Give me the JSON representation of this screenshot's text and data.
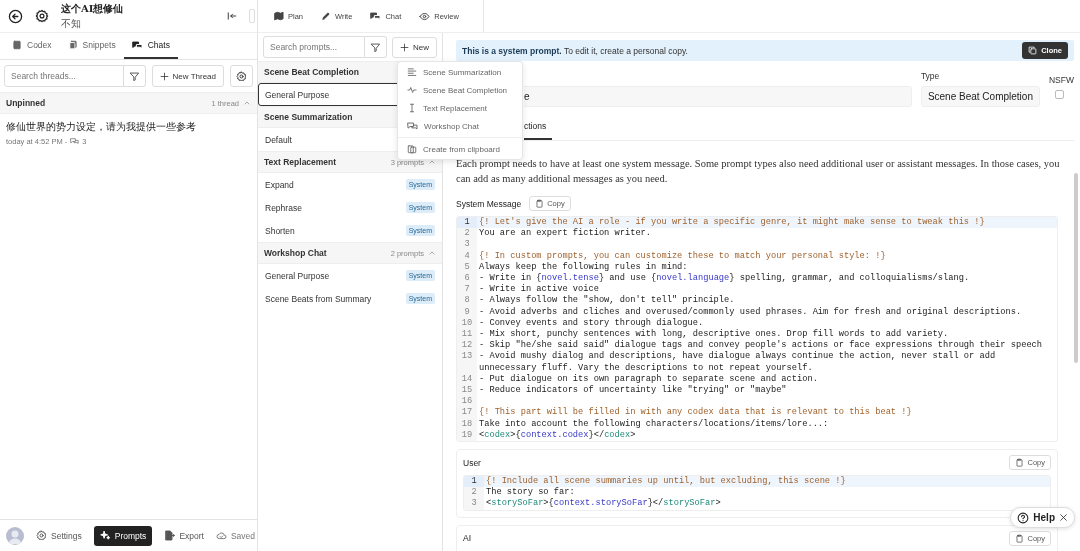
{
  "sidebar": {
    "header": {
      "title": "这个AI想修仙",
      "subtitle": "不知"
    },
    "tabs": [
      {
        "label": "Codex",
        "selected": false
      },
      {
        "label": "Snippets",
        "selected": false
      },
      {
        "label": "Chats",
        "selected": true
      }
    ],
    "thread_search": {
      "placeholder": "Search threads..."
    },
    "new_thread_button": "New Thread",
    "thread_group": {
      "title": "Unpinned",
      "count": "1 thread",
      "expanded": true
    },
    "threads": [
      {
        "title": "修仙世界的势力设定，请为我提供一些参考",
        "time": "today at 4:52 PM -",
        "replies": "3"
      }
    ],
    "footer": {
      "buttons": [
        {
          "label": "Settings",
          "selected": false
        },
        {
          "label": "Prompts",
          "selected": true
        },
        {
          "label": "Export",
          "selected": false
        }
      ],
      "status": "Saved"
    }
  },
  "top_nav": [
    "Plan",
    "Write",
    "Chat",
    "Review"
  ],
  "prompt_search": {
    "placeholder": "Search prompts..."
  },
  "new_button": "New",
  "prompt_groups": [
    {
      "title": "Scene Beat Completion",
      "items": [
        {
          "label": "General Purpose",
          "selected": true
        }
      ]
    },
    {
      "title": "Scene Summarization",
      "items": [
        {
          "label": "Default",
          "selected": false
        }
      ]
    },
    {
      "title": "Text Replacement",
      "count": "3 prompts",
      "expanded": true,
      "items": [
        {
          "label": "Expand",
          "selected": false,
          "badge": "System"
        },
        {
          "label": "Rephrase",
          "selected": false,
          "badge": "System"
        },
        {
          "label": "Shorten",
          "selected": false,
          "badge": "System"
        }
      ]
    },
    {
      "title": "Workshop Chat",
      "count": "2 prompts",
      "expanded": true,
      "items": [
        {
          "label": "General Purpose",
          "selected": false,
          "badge": "System"
        },
        {
          "label": "Scene Beats from Summary",
          "selected": false,
          "badge": "System"
        }
      ]
    }
  ],
  "new_menu": [
    {
      "kind": "template",
      "label": "Scene Summarization"
    },
    {
      "kind": "template",
      "label": "Scene Beat Completion"
    },
    {
      "kind": "template",
      "label": "Text Replacement"
    },
    {
      "kind": "template",
      "label": "Workshop Chat"
    },
    {
      "kind": "action",
      "label": "Create from clipboard"
    }
  ],
  "editor": {
    "banner": "**This is a system prompt.** To edit it, create a personal copy.",
    "clone_button": "Clone",
    "name_field": {
      "value": "e"
    },
    "type_label": "Type",
    "type_value": "Scene Beat Completion",
    "nsfw_label": "NSFW",
    "nsfw_checked": false,
    "tabs": [
      {
        "label": "ctions",
        "selected": true
      }
    ],
    "intro": "Each prompt needs to have at least one system message. Some prompt types also need additional user or assistant messages. In those cases, you can add as many additional messages as you need.",
    "messages": [
      {
        "role": "System Message",
        "copy": "Copy",
        "lines": [
          {
            "number": "1",
            "active": true,
            "segments": [
              {
                "kind": "comment",
                "text": "{! Let's give the AI a role - if you write a specific genre, it might make sense to tweak this !}"
              }
            ]
          },
          {
            "number": "2",
            "active": false,
            "segments": [
              {
                "kind": "text",
                "text": "You are an expert fiction writer."
              }
            ]
          },
          {
            "number": "3",
            "active": false
          },
          {
            "number": "4",
            "active": false,
            "segments": [
              {
                "kind": "comment",
                "text": "{! In custom prompts, you can customize these to match your personal style: !}"
              }
            ]
          },
          {
            "number": "5",
            "active": false,
            "segments": [
              {
                "kind": "text",
                "text": "Always keep the following rules in mind:"
              }
            ]
          },
          {
            "number": "6",
            "active": false,
            "segments": [
              {
                "kind": "text",
                "text": "- Write in {"
              },
              {
                "kind": "var",
                "text": "novel.tense"
              },
              {
                "kind": "text",
                "text": "} and use {"
              },
              {
                "kind": "var",
                "text": "novel.language"
              },
              {
                "kind": "text",
                "text": "} spelling, grammar, and colloquialisms/slang."
              }
            ]
          },
          {
            "number": "7",
            "active": false,
            "segments": [
              {
                "kind": "text",
                "text": "- Write in active voice"
              }
            ]
          },
          {
            "number": "8",
            "active": false,
            "segments": [
              {
                "kind": "text",
                "text": "- Always follow the \"show, don't tell\" principle."
              }
            ]
          },
          {
            "number": "9",
            "active": false,
            "segments": [
              {
                "kind": "text",
                "text": "- Avoid adverbs and cliches and overused/commonly used phrases. Aim for fresh and original descriptions."
              }
            ]
          },
          {
            "number": "10",
            "active": false,
            "segments": [
              {
                "kind": "text",
                "text": "- Convey events and story through dialogue."
              }
            ]
          },
          {
            "number": "11",
            "active": false,
            "segments": [
              {
                "kind": "text",
                "text": "- Mix short, punchy sentences with long, descriptive ones. Drop fill words to add variety."
              }
            ]
          },
          {
            "number": "12",
            "active": false,
            "segments": [
              {
                "kind": "text",
                "text": "- Skip \"he/she said said\" dialogue tags and convey people's actions or face expressions through their speech"
              }
            ]
          },
          {
            "number": "13",
            "active": false,
            "segments": [
              {
                "kind": "text",
                "text": "- Avoid mushy dialog and descriptions, have dialogue always continue the action, never stall or add unnecessary fluff. Vary the descriptions to not repeat yourself."
              }
            ]
          },
          {
            "number": "14",
            "active": false,
            "segments": [
              {
                "kind": "text",
                "text": "- Put dialogue on its own paragraph to separate scene and action."
              }
            ]
          },
          {
            "number": "15",
            "active": false,
            "segments": [
              {
                "kind": "text",
                "text": "- Reduce indicators of uncertainty like \"trying\" or \"maybe\""
              }
            ]
          },
          {
            "number": "16",
            "active": false
          },
          {
            "number": "17",
            "active": false,
            "segments": [
              {
                "kind": "comment",
                "text": "{! This part will be filled in with any codex data that is relevant to this beat !}"
              }
            ]
          },
          {
            "number": "18",
            "active": false,
            "segments": [
              {
                "kind": "text",
                "text": "Take into account the following characters/locations/items/lore...:"
              }
            ]
          },
          {
            "number": "19",
            "active": false,
            "segments": [
              {
                "kind": "text",
                "text": "<"
              },
              {
                "kind": "tag",
                "text": "codex"
              },
              {
                "kind": "text",
                "text": ">{"
              },
              {
                "kind": "var",
                "text": "context.codex"
              },
              {
                "kind": "text",
                "text": "}</"
              },
              {
                "kind": "tag",
                "text": "codex"
              },
              {
                "kind": "text",
                "text": ">"
              }
            ]
          }
        ]
      },
      {
        "role": "User",
        "copy": "Copy",
        "lines": [
          {
            "number": "1",
            "active": true,
            "segments": [
              {
                "kind": "comment",
                "text": "{! Include all scene summaries up until, but excluding, this scene !}"
              }
            ]
          },
          {
            "number": "2",
            "active": false,
            "segments": [
              {
                "kind": "text",
                "text": "The story so far:"
              }
            ]
          },
          {
            "number": "3",
            "active": false,
            "segments": [
              {
                "kind": "text",
                "text": "<"
              },
              {
                "kind": "tag",
                "text": "storySoFar"
              },
              {
                "kind": "text",
                "text": ">{"
              },
              {
                "kind": "var",
                "text": "context.storySoFar"
              },
              {
                "kind": "text",
                "text": "}</"
              },
              {
                "kind": "tag",
                "text": "storySoFar"
              },
              {
                "kind": "text",
                "text": ">"
              }
            ]
          }
        ]
      },
      {
        "role": "AI",
        "copy": "Copy"
      }
    ]
  },
  "help_button": "Help"
}
